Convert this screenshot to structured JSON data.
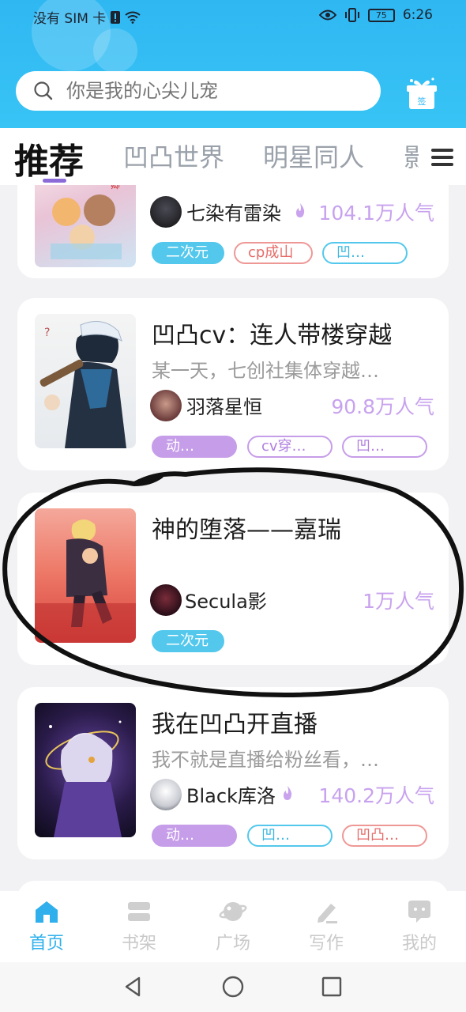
{
  "status_bar": {
    "carrier": "没有 SIM 卡",
    "battery": "75",
    "time": "6:26"
  },
  "search": {
    "placeholder": "你是我的心尖儿宠"
  },
  "gift_icon": "sign-in-gift-icon",
  "gift_label": "签",
  "tabs": [
    "推荐",
    "凹凸世界",
    "明星同人",
    "影视"
  ],
  "active_tab": 0,
  "cards": [
    {
      "title": "",
      "author": "七染有雷染",
      "hot": true,
      "popularity": "104.1万人气",
      "tags": [
        "二次元",
        "cp成山",
        "凹…"
      ]
    },
    {
      "title": "凹凸cv：连人带楼穿越",
      "desc": "某一天，七创社集体穿越…",
      "author": "羽落星恒",
      "hot": false,
      "popularity": "90.8万人气",
      "tags": [
        "动…",
        "cv穿…",
        "凹…"
      ]
    },
    {
      "title": "神的堕落——嘉瑞",
      "desc": "",
      "author": "Secula影",
      "hot": false,
      "popularity": "1万人气",
      "tags": [
        "二次元"
      ]
    },
    {
      "title": "我在凹凸开直播",
      "desc": "我不就是直播给粉丝看，…",
      "author": "Black库洛",
      "hot": true,
      "popularity": "140.2万人气",
      "tags": [
        "动…",
        "凹…",
        "凹凸…"
      ]
    }
  ],
  "bottom_nav": [
    "首页",
    "书架",
    "广场",
    "写作",
    "我的"
  ],
  "active_nav": 0,
  "colors": {
    "header": "#2fb7f2",
    "accent_blue": "#2fb0ec",
    "popularity": "#c8a2ee",
    "tag_cyan": "#53c8ec",
    "tag_purple": "#c69de9",
    "tag_red": "#ee9896"
  }
}
